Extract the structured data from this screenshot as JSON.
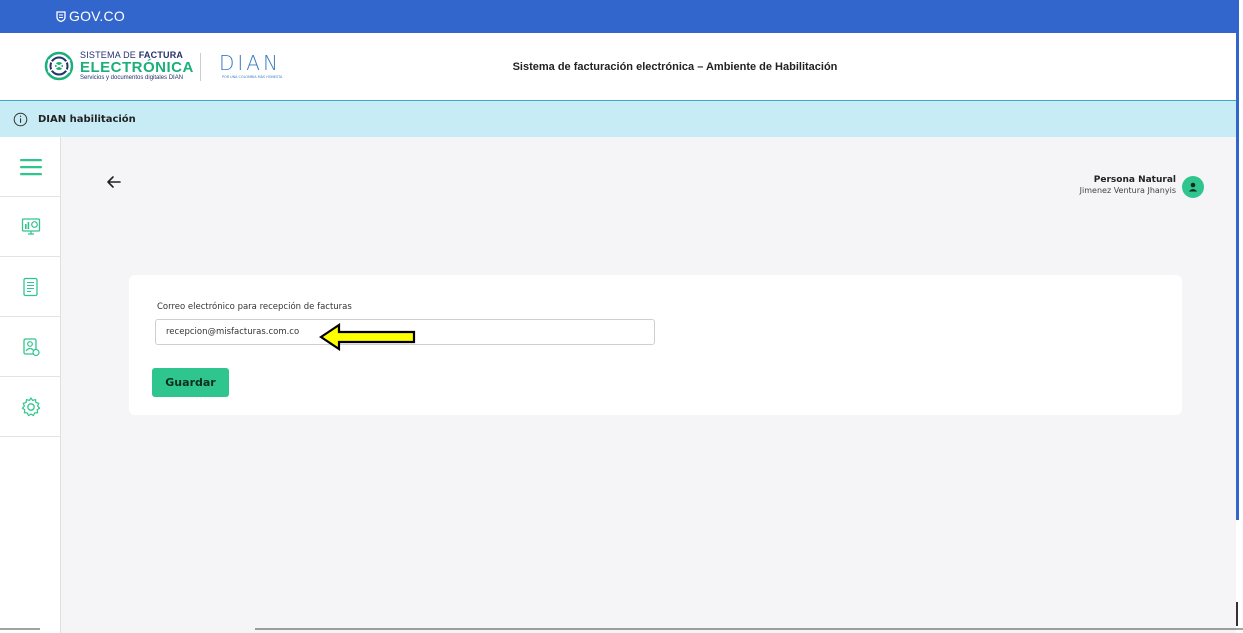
{
  "gov_bar": {
    "label": "GOV.CO"
  },
  "header": {
    "logo_line1_prefix": "SISTEMA DE ",
    "logo_line1_bold": "FACTURA",
    "logo_line2": "ELECTRÓNICA",
    "logo_line3": "Servicios y documentos digitales DIAN",
    "dian_logo": "DIAN",
    "dian_tagline": "POR UNA COLOMBIA MÁS HONESTA",
    "title": "Sistema de facturación electrónica – Ambiente de Habilitación"
  },
  "info_bar": {
    "text": "DIAN habilitación",
    "icon": "info-icon"
  },
  "sidebar": {
    "items": [
      {
        "icon": "menu-icon"
      },
      {
        "icon": "dashboard-monitor-icon"
      },
      {
        "icon": "document-icon"
      },
      {
        "icon": "user-document-icon"
      },
      {
        "icon": "gear-icon"
      }
    ]
  },
  "user": {
    "role": "Persona Natural",
    "name": "Jimenez Ventura Jhanyis",
    "icon": "user-avatar-icon"
  },
  "form": {
    "label": "Correo electrónico para recepción de facturas",
    "value": "recepcion@misfacturas.com.co",
    "save_label": "Guardar"
  },
  "colors": {
    "gov_blue": "#3366cc",
    "info_bar": "#c8ecf5",
    "accent_green": "#2fc58e",
    "pointer_yellow": "#ffff00"
  }
}
